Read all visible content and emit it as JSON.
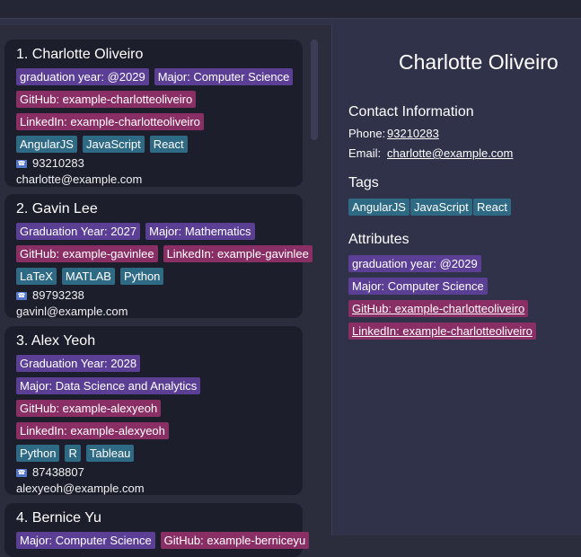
{
  "contacts": [
    {
      "index_name": "1. Charlotte Oliveiro",
      "grad": "graduation year: @2029",
      "major": "Major: Computer Science",
      "github": "GitHub: example-charlotteoliveiro",
      "linkedin": "LinkedIn: example-charlotteoliveiro",
      "tags": [
        "AngularJS",
        "JavaScript",
        "React"
      ],
      "phone": "93210283",
      "email": "charlotte@example.com"
    },
    {
      "index_name": "2. Gavin Lee",
      "grad": "Graduation Year: 2027",
      "major": "Major: Mathematics",
      "github": "GitHub: example-gavinlee",
      "linkedin": "LinkedIn: example-gavinlee",
      "tags": [
        "LaTeX",
        "MATLAB",
        "Python"
      ],
      "phone": "89793238",
      "email": "gavinl@example.com"
    },
    {
      "index_name": "3. Alex Yeoh",
      "grad": "Graduation Year: 2028",
      "major": "Major: Data Science and Analytics",
      "github": "GitHub: example-alexyeoh",
      "linkedin": "LinkedIn: example-alexyeoh",
      "tags": [
        "Python",
        "R",
        "Tableau"
      ],
      "phone": "87438807",
      "email": "alexyeoh@example.com"
    },
    {
      "index_name": "4. Bernice Yu",
      "major": "Major: Computer Science",
      "github": "GitHub: example-berniceyu"
    }
  ],
  "detail": {
    "name": "Charlotte Oliveiro",
    "contact_heading": "Contact Information",
    "phone_label": "Phone:",
    "phone": "93210283",
    "email_label": "Email:",
    "email": "charlotte@example.com",
    "tags_heading": "Tags",
    "tags": [
      "AngularJS",
      "JavaScript",
      "React"
    ],
    "attributes_heading": "Attributes",
    "attributes": [
      "graduation year: @2029",
      "Major: Computer Science",
      "GitHub: example-charlotteoliveiro",
      "LinkedIn: example-charlotteoliveiro"
    ]
  },
  "colors": {
    "background": "#2b2d3d",
    "card": "#1c1e2b",
    "attribute_chip": "#5b3f95",
    "link_chip": "#8a2e66",
    "tag_chip": "#2f6a85"
  },
  "icons": {
    "phone": "phone-icon"
  }
}
